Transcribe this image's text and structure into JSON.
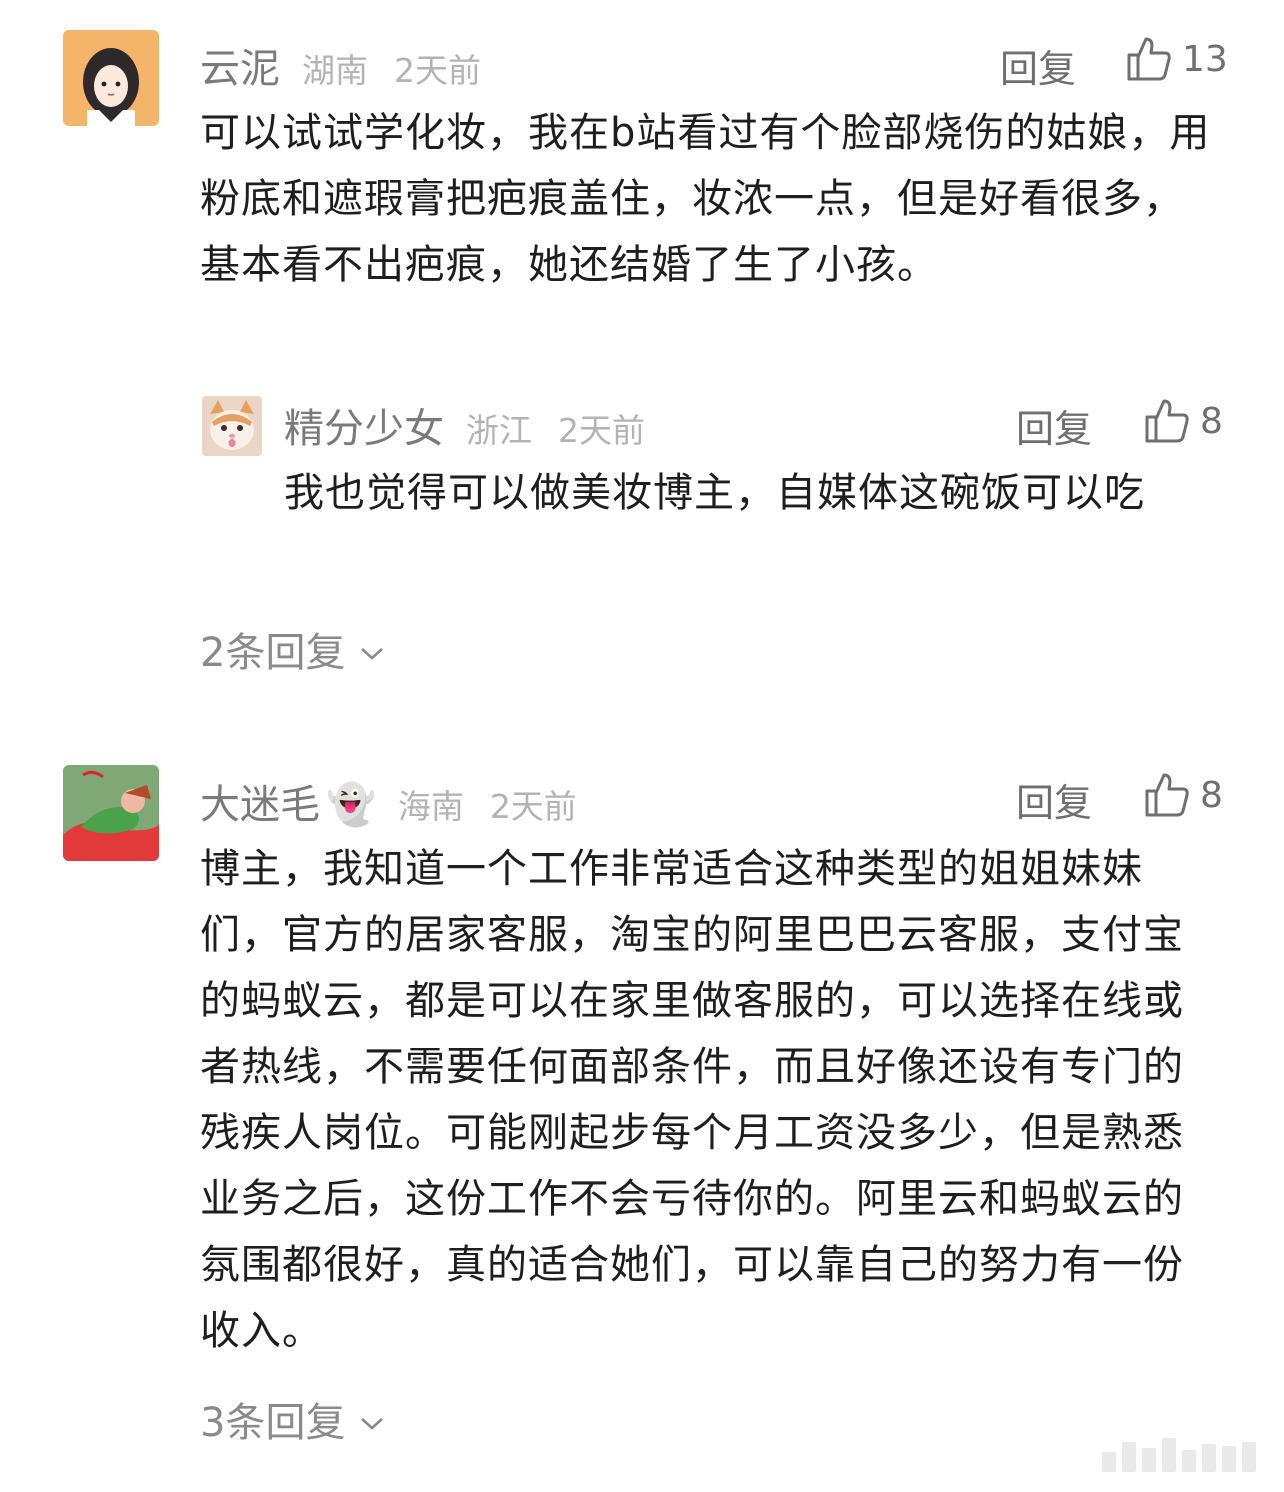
{
  "comments": [
    {
      "username": "云泥",
      "region": "湖南",
      "time": "2天前",
      "reply_label": "回复",
      "likes": "13",
      "text": "可以试试学化妆，我在b站看过有个脸部烧伤的姑娘，用粉底和遮瑕膏把疤痕盖住，妆浓一点，但是好看很多，基本看不出疤痕，她还结婚了生了小孩。",
      "sub_reply": {
        "username": "精分少女",
        "region": "浙江",
        "time": "2天前",
        "reply_label": "回复",
        "likes": "8",
        "text": "我也觉得可以做美妆博主，自媒体这碗饭可以吃"
      },
      "more_replies": "2条回复"
    },
    {
      "username": "大迷毛",
      "username_emoji": "👻",
      "region": "海南",
      "time": "2天前",
      "reply_label": "回复",
      "likes": "8",
      "text": "博主，我知道一个工作非常适合这种类型的姐姐妹妹们，官方的居家客服，淘宝的阿里巴巴云客服，支付宝的蚂蚁云，都是可以在家里做客服的，可以选择在线或者热线，不需要任何面部条件，而且好像还设有专门的残疾人岗位。可能刚起步每个月工资没多少，但是熟悉业务之后，这份工作不会亏待你的。阿里云和蚂蚁云的氛围都很好，真的适合她们，可以靠自己的努力有一份收入。",
      "more_replies": "3条回复"
    }
  ],
  "icons": {
    "like": "thumbs-up-icon",
    "expand": "chevron-down-icon",
    "ghost_emoji": "ghost-emoji"
  }
}
